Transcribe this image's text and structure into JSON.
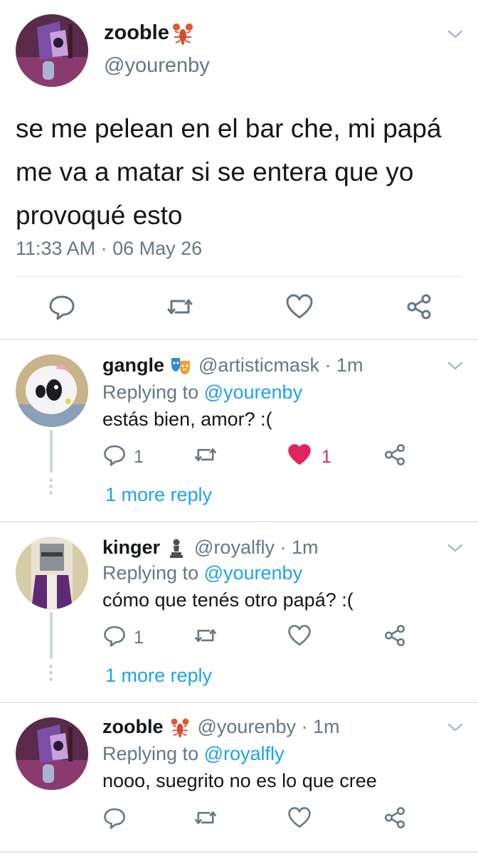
{
  "main_tweet": {
    "display_name": "zooble",
    "name_emoji": "lobster-emoji",
    "handle": "@yourenby",
    "text": "se me pelean en el bar che, mi papá me va a matar si se entera que yo provoqué esto",
    "timestamp": "11:33 AM · 06 May 26",
    "actions": [
      "reply-icon",
      "retweet-icon",
      "like-icon",
      "share-icon"
    ]
  },
  "replies": [
    {
      "display_name": "gangle",
      "name_emoji": "performing-arts-emoji",
      "meta": "@artisticmask · 1m",
      "replying_prefix": "Replying to ",
      "replying_to": "@yourenby",
      "text": "estás bien, amor? :(",
      "reply_count": "1",
      "like_count": "1",
      "liked": true,
      "more_replies": "1 more reply"
    },
    {
      "display_name": "kinger",
      "name_emoji": "chess-pawn-emoji",
      "meta": "@royalfly · 1m",
      "replying_prefix": "Replying to ",
      "replying_to": "@yourenby",
      "text": "cómo que tenés otro papá? :(",
      "reply_count": "1",
      "like_count": "",
      "liked": false,
      "more_replies": "1 more reply"
    },
    {
      "display_name": "zooble",
      "name_emoji": "lobster-emoji",
      "meta": "@yourenby · 1m",
      "replying_prefix": "Replying to ",
      "replying_to": "@royalfly",
      "text": "nooo, suegrito no es lo que cree",
      "reply_count": "",
      "like_count": "",
      "liked": false,
      "more_replies": ""
    }
  ],
  "colors": {
    "link": "#1da1f2",
    "secondary_text": "#657786",
    "like_active": "#e0245e",
    "divider": "#e1e8ed"
  }
}
